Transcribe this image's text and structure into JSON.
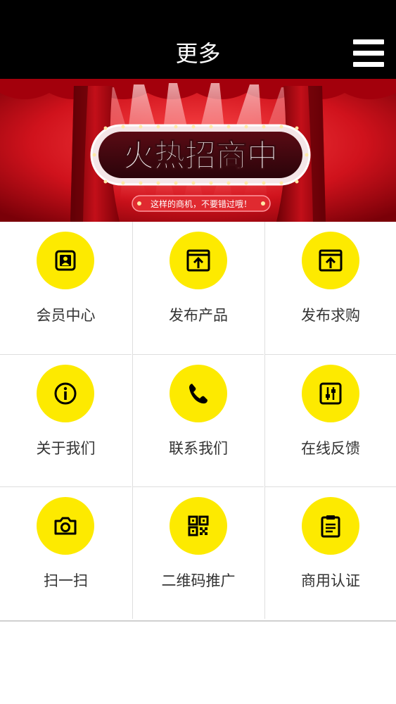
{
  "header": {
    "title": "更多",
    "menu_icon": "hamburger-menu-icon"
  },
  "banner": {
    "headline": "火热招商中",
    "tagline": "这样的商机，不要错过哦！"
  },
  "grid": {
    "items": [
      {
        "label": "会员中心",
        "icon": "member-card-icon"
      },
      {
        "label": "发布产品",
        "icon": "upload-window-icon"
      },
      {
        "label": "发布求购",
        "icon": "upload-window-icon"
      },
      {
        "label": "关于我们",
        "icon": "info-icon"
      },
      {
        "label": "联系我们",
        "icon": "phone-icon"
      },
      {
        "label": "在线反馈",
        "icon": "sliders-icon"
      },
      {
        "label": "扫一扫",
        "icon": "camera-icon"
      },
      {
        "label": "二维码推广",
        "icon": "qr-code-icon"
      },
      {
        "label": "商用认证",
        "icon": "clipboard-icon"
      }
    ]
  },
  "colors": {
    "header_bg": "#000000",
    "icon_circle": "#fdea00",
    "banner_red": "#c4121a",
    "label_text": "#333333"
  }
}
